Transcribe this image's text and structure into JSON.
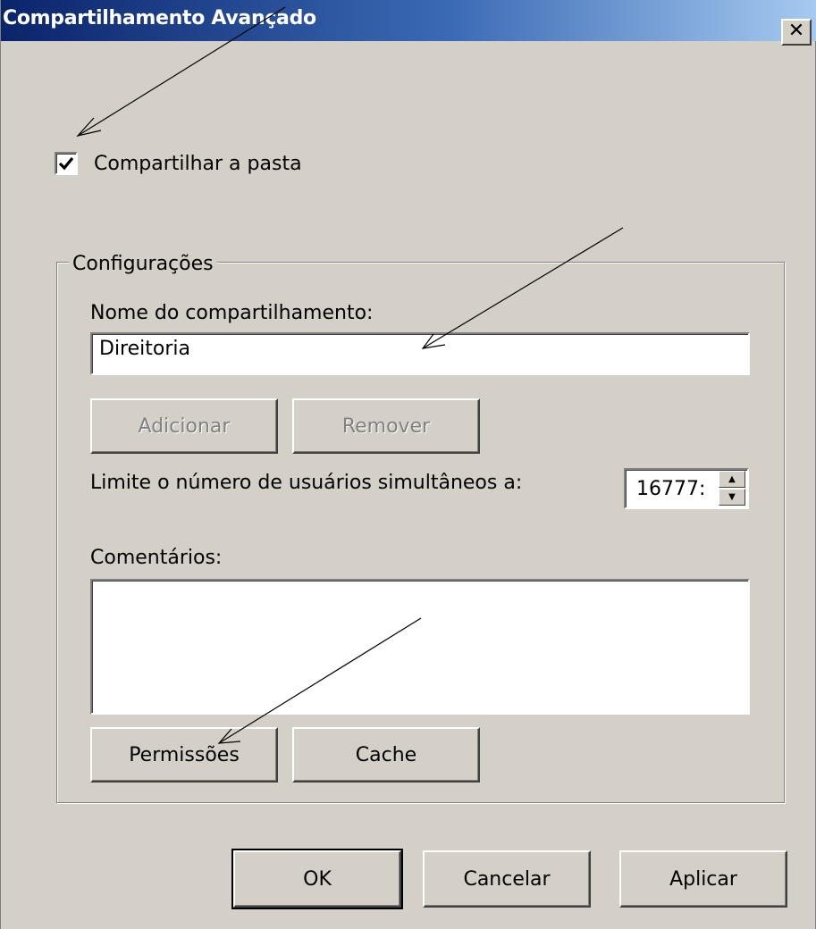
{
  "dialog": {
    "title": "Compartilhamento Avançado",
    "close_glyph": "✕"
  },
  "share_checkbox": {
    "label": "Compartilhar a pasta",
    "checked": true
  },
  "settings": {
    "legend": "Configurações",
    "share_name_label": "Nome do compartilhamento:",
    "share_name_value": "Direitoria",
    "add_button": "Adicionar",
    "remove_button": "Remover",
    "limit_label": "Limite o número de usuários simultâneos a:",
    "limit_value": "16777:",
    "comments_label": "Comentários:",
    "comments_value": "",
    "permissions_button": "Permissões",
    "cache_button": "Cache"
  },
  "footer": {
    "ok_button": "OK",
    "cancel_button": "Cancelar",
    "apply_button": "Aplicar"
  },
  "colors": {
    "face": "#d4d0c8",
    "title_start": "#0a246a",
    "title_end": "#a6caf0"
  }
}
